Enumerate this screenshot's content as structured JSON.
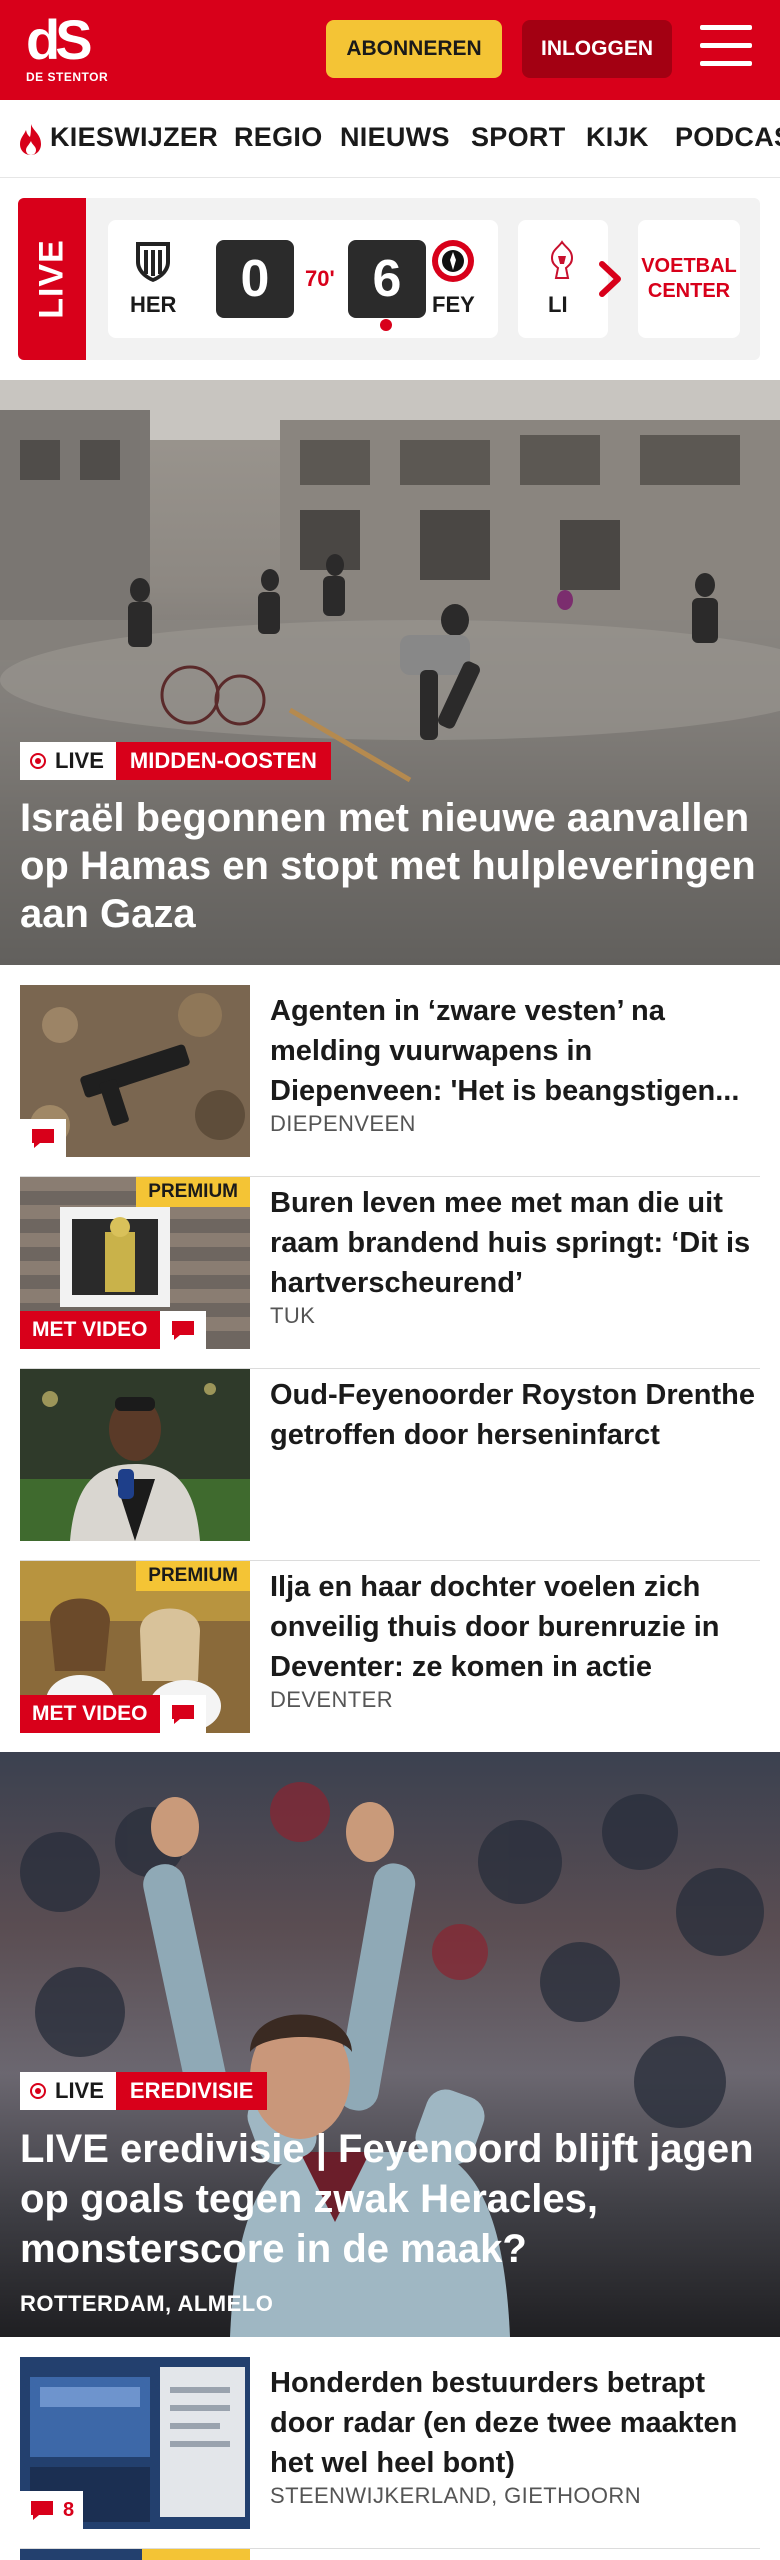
{
  "header": {
    "logo_mark": "dS",
    "logo_sub": "DE STENTOR",
    "subscribe_label": "ABONNEREN",
    "login_label": "INLOGGEN"
  },
  "nav": {
    "items": [
      "KIESWIJZER",
      "REGIO",
      "NIEUWS",
      "SPORT",
      "KIJK",
      "PODCAS"
    ]
  },
  "livebar": {
    "label": "LIVE",
    "match": {
      "home_code": "HER",
      "home_score": "0",
      "minute": "70'",
      "away_score": "6",
      "away_code": "FEY"
    },
    "next_match_code": "LI",
    "voetbal_center_label": "VOETBAL CENTER"
  },
  "hero_1": {
    "live_label": "LIVE",
    "category": "MIDDEN-OOSTEN",
    "title": "Israël begonnen met nieuwe aanvallen op Hamas en stopt met hulpleveringen aan Gaza"
  },
  "articles": [
    {
      "title": "Agenten in ‘zware vesten’ na melding vuurwapens in Diepenveen: 'Het is beangstigen...",
      "location": "DIEPENVEEN",
      "premium": "",
      "video": "",
      "comments": ""
    },
    {
      "title": "Buren leven mee met man die uit raam brandend huis springt: ‘Dit is hartverscheurend’",
      "location": "TUK",
      "premium": "PREMIUM",
      "video": "MET VIDEO",
      "comments": ""
    },
    {
      "title": "Oud-Feyenoorder Royston Drenthe getroffen door hersenin­farct",
      "location": "",
      "premium": "",
      "video": "",
      "comments": ""
    },
    {
      "title": "Ilja en haar dochter voelen zich onveilig thuis door burenruzie in Deventer: ze komen in actie",
      "location": "DEVENTER",
      "premium": "PREMIUM",
      "video": "MET VIDEO",
      "comments": ""
    }
  ],
  "hero_2": {
    "live_label": "LIVE",
    "category": "EREDIVISIE",
    "title": "LIVE eredivisie | Feyenoord blijft jagen op goals tegen zwak Heracles, monsterscore in de maak?",
    "location": "ROTTERDAM, ALMELO"
  },
  "articles_2": [
    {
      "title": "Honderden bestuurders betrapt door radar (en deze twee maakten het wel heel bont)",
      "location": "STEENWIJKERLAND, GIETHOORN",
      "comments": "8"
    }
  ],
  "colors": {
    "brand_red": "#d8001a",
    "dark_red": "#a30012",
    "premium_yellow": "#f4c435"
  }
}
